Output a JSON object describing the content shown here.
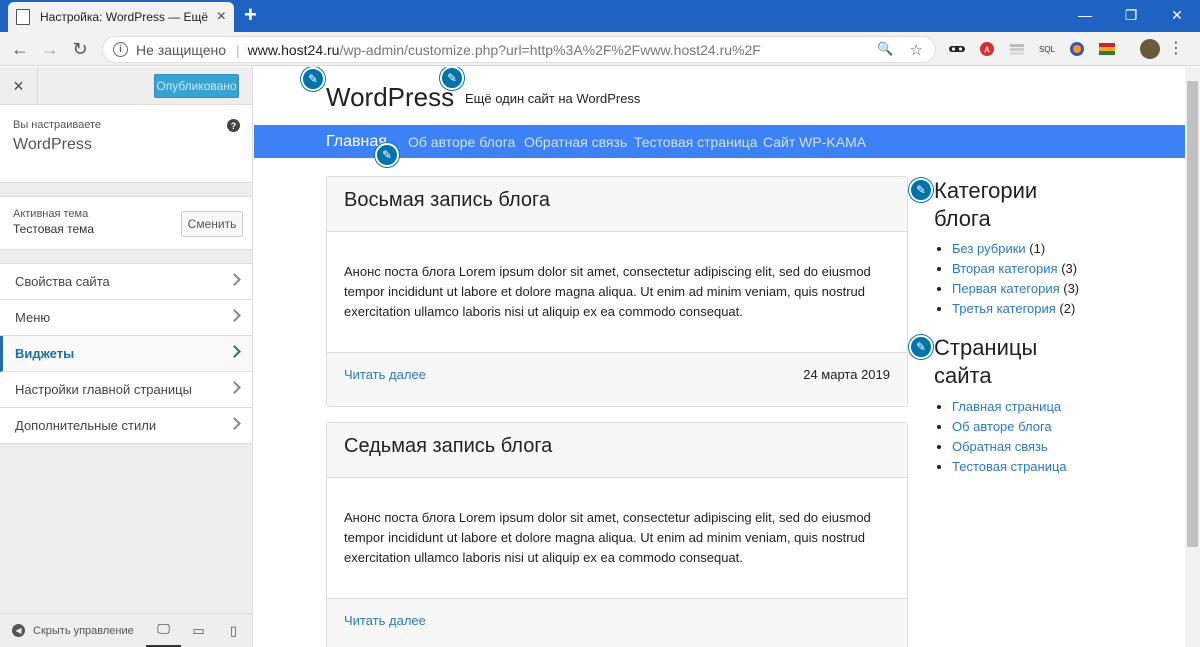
{
  "browser": {
    "tab_title": "Настройка: WordPress — Ещё о",
    "tab_close": "×",
    "new_tab": "+",
    "win_min": "—",
    "win_max": "❐",
    "win_close": "✕",
    "nav_back": "←",
    "nav_forward": "→",
    "nav_reload": "↻",
    "security_text": "Не защищено",
    "separator": "|",
    "url_host": "www.host24.ru",
    "url_path": "/wp-admin/customize.php?url=http%3A%2F%2Fwww.host24.ru%2F",
    "zoom_icon": "🔍",
    "star_icon": "☆",
    "extensions": [
      "mask-icon",
      "adblock-icon",
      "layers-icon",
      "sql-icon",
      "globe-icon",
      "flag-icon"
    ],
    "ext_sql": "SQL",
    "menu_dots": "⋮"
  },
  "sidebar": {
    "close": "×",
    "publish_label": "Опубликовано",
    "customizing_label": "Вы настраиваете",
    "site_name": "WordPress",
    "help": "?",
    "active_theme_label": "Активная тема",
    "theme_name": "Тестовая тема",
    "change_label": "Сменить",
    "items": [
      {
        "label": "Свойства сайта"
      },
      {
        "label": "Меню"
      },
      {
        "label": "Виджеты"
      },
      {
        "label": "Настройки главной страницы"
      },
      {
        "label": "Дополнительные стили"
      }
    ],
    "collapse_label": "Скрыть управление",
    "collapse_icon": "◀",
    "device_desktop": "🖵",
    "device_tablet": "▭",
    "device_mobile": "▯"
  },
  "site": {
    "title": "WordPress",
    "description": "Ещё один сайт на WordPress",
    "nav": [
      "Главная",
      "Об авторе блога",
      "Обратная связь",
      "Тестовая страница",
      "Сайт WP-KAMA"
    ],
    "posts": [
      {
        "title": "Восьмая запись блога",
        "excerpt": "Анонс поста блога Lorem ipsum dolor sit amet, consectetur adipiscing elit, sed do eiusmod tempor incididunt ut labore et dolore magna aliqua. Ut enim ad minim veniam, quis nostrud exercitation ullamco laboris nisi ut aliquip ex ea commodo consequat.",
        "read_more": "Читать далее",
        "date": "24 марта 2019"
      },
      {
        "title": "Седьмая запись блога",
        "excerpt": "Анонс поста блога Lorem ipsum dolor sit amet, consectetur adipiscing elit, sed do eiusmod tempor incididunt ut labore et dolore magna aliqua. Ut enim ad minim veniam, quis nostrud exercitation ullamco laboris nisi ut aliquip ex ea commodo consequat.",
        "read_more": "Читать далее",
        "date": ""
      }
    ],
    "widgets": {
      "categories_title_1": "Категории",
      "categories_title_2": "блога",
      "categories": [
        {
          "name": "Без рубрики",
          "count": "(1)"
        },
        {
          "name": "Вторая категория",
          "count": "(3)"
        },
        {
          "name": "Первая категория",
          "count": "(3)"
        },
        {
          "name": "Третья категория",
          "count": "(2)"
        }
      ],
      "pages_title_1": "Страницы",
      "pages_title_2": "сайта",
      "pages": [
        "Главная страница",
        "Об авторе блога",
        "Обратная связь",
        "Тестовая страница"
      ]
    },
    "edit_icon": "✎"
  },
  "colors": {
    "accent": "#0073aa",
    "navbar": "#3c82f6",
    "link": "#2b78c8",
    "chrome": "#1f63c2"
  }
}
